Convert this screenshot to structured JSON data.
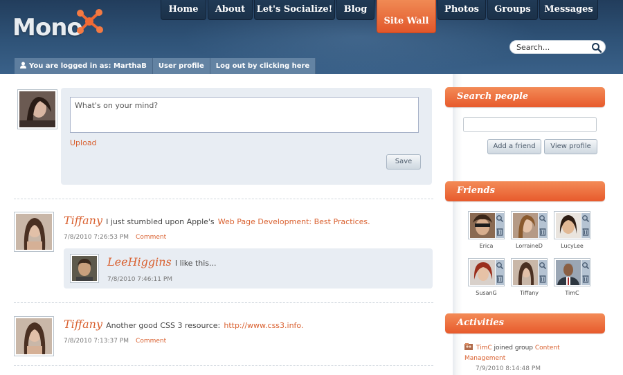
{
  "brand": {
    "logo_text": "Mono"
  },
  "nav": {
    "items": [
      "Home",
      "About",
      "Let's Socialize!",
      "Blog",
      "Site Wall",
      "Photos",
      "Groups",
      "Messages"
    ],
    "active": "Site Wall"
  },
  "search": {
    "placeholder": "Search..."
  },
  "userbar": {
    "logged_in": "You are logged in as: MarthaB",
    "profile": "User profile",
    "logout": "Log out by clicking here"
  },
  "composer": {
    "placeholder": "What's on your mind?",
    "upload": "Upload",
    "save": "Save"
  },
  "posts": [
    {
      "author": "Tiffany",
      "text": "I just stumbled upon Apple's",
      "link": "Web Page Development: Best Practices.",
      "time": "7/8/2010 7:26:53 PM",
      "comment": "Comment",
      "replies": [
        {
          "author": "LeeHiggins",
          "text": "I like this...",
          "time": "7/8/2010 7:46:11 PM"
        }
      ]
    },
    {
      "author": "Tiffany",
      "text": "Another good CSS 3 resource:",
      "link": "http://www.css3.info.",
      "time": "7/8/2010 7:13:37 PM",
      "comment": "Comment"
    }
  ],
  "sidebar": {
    "search_people": {
      "title": "Search people",
      "add_friend": "Add a friend",
      "view_profile": "View profile"
    },
    "friends": {
      "title": "Friends",
      "list": [
        "Erica",
        "LorraineD",
        "LucyLee",
        "SusanG",
        "Tiffany",
        "TimC"
      ]
    },
    "activities": {
      "title": "Activities",
      "items": [
        {
          "user": "TimC",
          "action": "joined group",
          "target": "Content Management",
          "time": "7/9/2010 8:14:48 PM"
        }
      ]
    }
  },
  "colors": {
    "accent": "#e75a2c",
    "link": "#d9602f",
    "header": "#2f5378",
    "panel": "#e8edf3"
  }
}
